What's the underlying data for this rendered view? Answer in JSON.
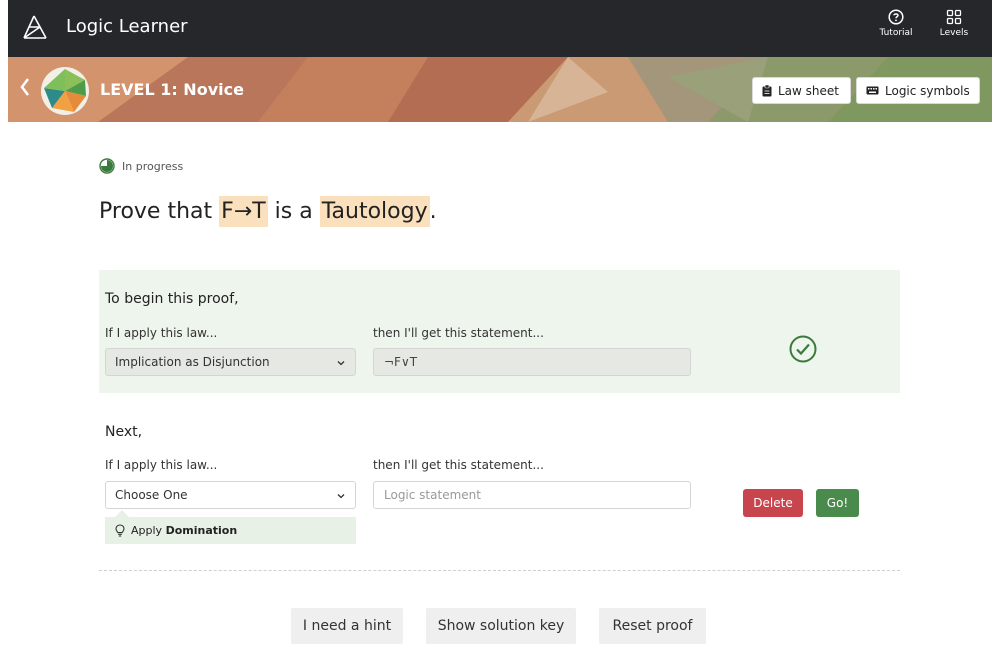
{
  "app": {
    "title": "Logic Learner"
  },
  "topnav": {
    "tutorial_label": "Tutorial",
    "levels_label": "Levels"
  },
  "banner": {
    "level_title": "LEVEL 1: Novice",
    "law_sheet_label": "Law sheet",
    "logic_symbols_label": "Logic symbols"
  },
  "status": {
    "text": "In progress"
  },
  "problem": {
    "prefix": "Prove that",
    "expression": "F→T",
    "middle": "is a",
    "target": "Tautology",
    "suffix": "."
  },
  "steps": [
    {
      "title": "To begin this proof,",
      "law_label": "If I apply this law...",
      "statement_label": "then I'll get this statement...",
      "law_value": "Implication as Disjunction",
      "statement_value": "¬F∨T",
      "status_icon": "check-circle-icon"
    },
    {
      "title": "Next,",
      "law_label": "If I apply this law...",
      "statement_label": "then I'll get this statement...",
      "law_value": "Choose One",
      "statement_placeholder": "Logic statement",
      "hint_prefix": "Apply",
      "hint_law": "Domination",
      "delete_label": "Delete",
      "go_label": "Go!"
    }
  ],
  "footer": {
    "hint_label": "I need a hint",
    "solution_label": "Show solution key",
    "reset_label": "Reset proof"
  },
  "colors": {
    "topbar": "#26272b",
    "highlight": "#fbe0bd",
    "step_bg": "#eef5ec",
    "delete": "#c8454d",
    "go": "#4a8a4c",
    "check": "#3b7a3e"
  }
}
